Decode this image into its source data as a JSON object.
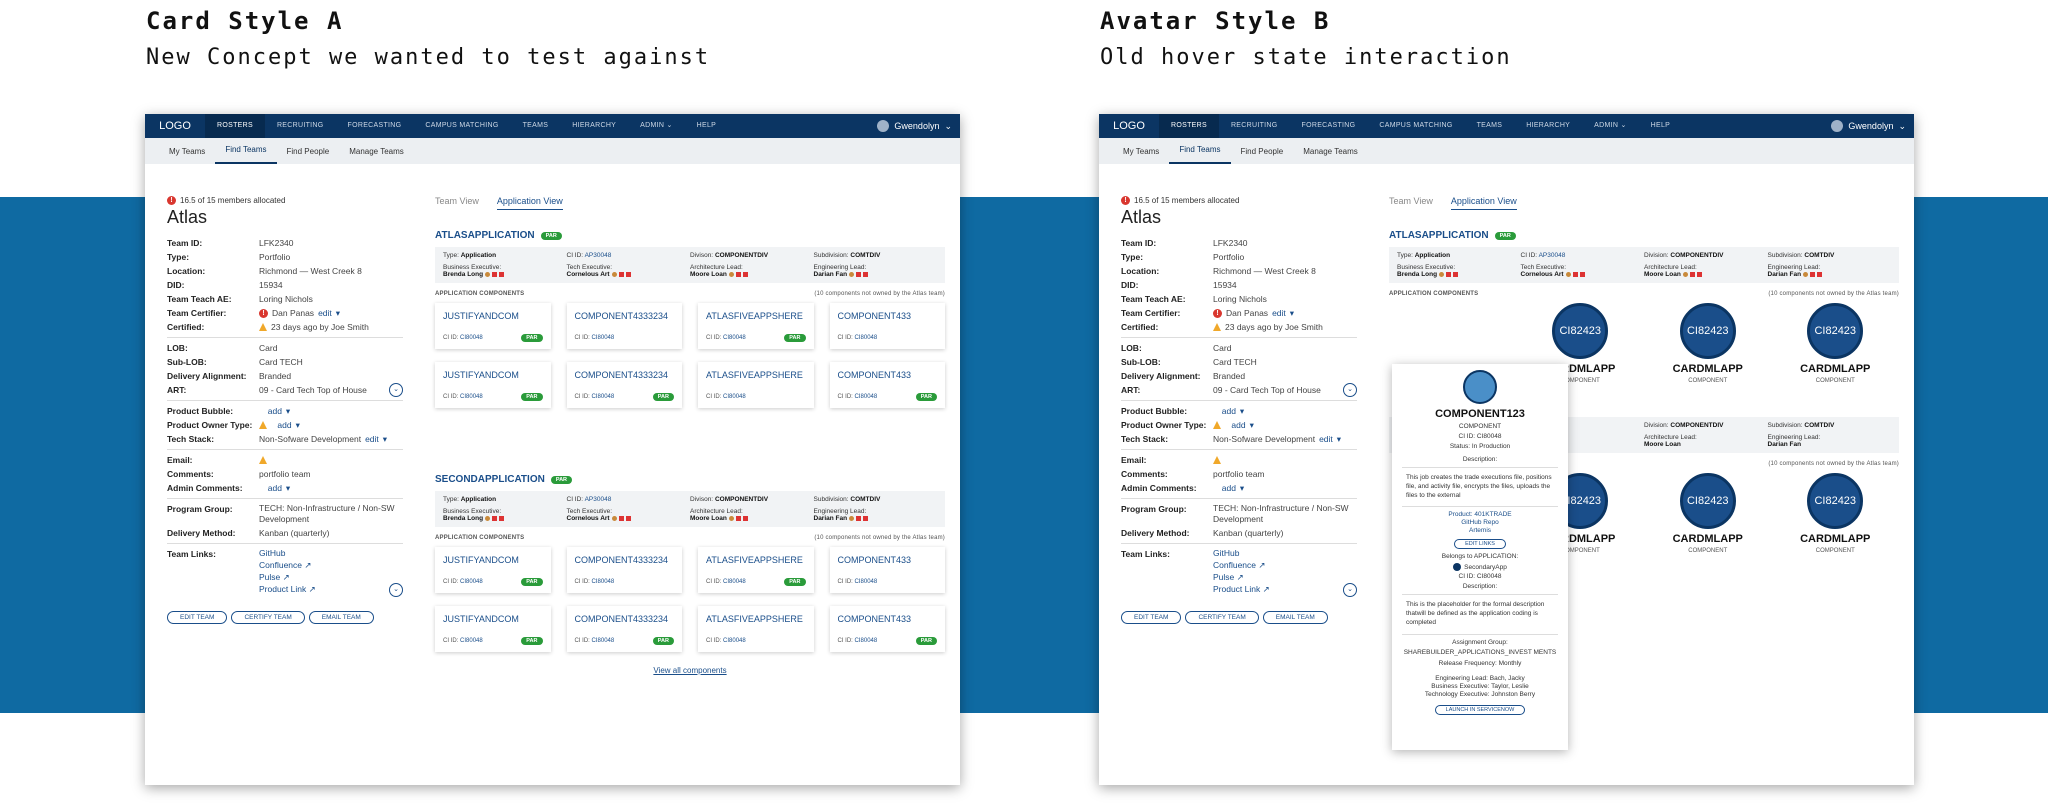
{
  "labels": {
    "a_title": "Card Style A",
    "a_subtitle": "New Concept we wanted to test against",
    "b_title": "Avatar Style B",
    "b_subtitle": "Old hover state interaction"
  },
  "nav": {
    "logo": "LOGO",
    "items": [
      "ROSTERS",
      "RECRUITING",
      "FORECASTING",
      "CAMPUS MATCHING",
      "TEAMS",
      "HIERARCHY",
      "ADMIN",
      "HELP"
    ],
    "user": "Gwendolyn"
  },
  "subnav": [
    "My Teams",
    "Find Teams",
    "Find People",
    "Manage Teams"
  ],
  "team": {
    "allocation": "16.5 of 15 members allocated",
    "name": "Atlas",
    "fields": {
      "team_id": {
        "k": "Team ID:",
        "v": "LFK2340"
      },
      "type": {
        "k": "Type:",
        "v": "Portfolio"
      },
      "location": {
        "k": "Location:",
        "v": "Richmond — West Creek 8"
      },
      "did": {
        "k": "DID:",
        "v": "15934"
      },
      "teach_ae": {
        "k": "Team Teach AE:",
        "v": "Loring Nichols"
      },
      "certifier": {
        "k": "Team Certifier:",
        "v": "Dan Panas",
        "edit": "edit"
      },
      "certified": {
        "k": "Certified:",
        "v": "23 days ago by Joe Smith"
      },
      "lob": {
        "k": "LOB:",
        "v": "Card"
      },
      "sublob": {
        "k": "Sub-LOB:",
        "v": "Card TECH"
      },
      "delivery_alignment": {
        "k": "Delivery Alignment:",
        "v": "Branded"
      },
      "art": {
        "k": "ART:",
        "v": "09 - Card Tech Top of House"
      },
      "product_bubble": {
        "k": "Product Bubble:",
        "v": "add"
      },
      "product_owner": {
        "k": "Product Owner Type:",
        "v": "add"
      },
      "tech_stack": {
        "k": "Tech Stack:",
        "v": "Non-Sofware Development",
        "edit": "edit"
      },
      "email": {
        "k": "Email:",
        "v": ""
      },
      "comments": {
        "k": "Comments:",
        "v": "portfolio team"
      },
      "admin_comments": {
        "k": "Admin Comments:",
        "v": "add"
      },
      "program_group": {
        "k": "Program Group:",
        "v": "TECH: Non-Infrastructure / Non-SW Development"
      },
      "delivery_method": {
        "k": "Delivery Method:",
        "v": "Kanban (quarterly)"
      },
      "team_links": {
        "k": "Team Links:",
        "links": [
          "GitHub",
          "Confluence",
          "Pulse",
          "Product Link"
        ]
      }
    },
    "buttons": [
      "EDIT TEAM",
      "CERTIFY TEAM",
      "EMAIL TEAM"
    ]
  },
  "view_tabs": [
    "Team View",
    "Application View"
  ],
  "apps": [
    {
      "name": "ATLASAPPLICATION",
      "badge": "PAR",
      "type": "Application",
      "ci_id": "AP30048",
      "division": "COMPONENTDIV",
      "subdivision": "COMTDIV",
      "business_exec": "Brenda Long",
      "tech_exec": "Cornelous Art",
      "arch_lead": "Moore Loan",
      "eng_lead": "Darian Fan",
      "components_label": "APPLICATION COMPONENTS",
      "components_note": "(10 components not owned by the Atlas team)",
      "cards": [
        {
          "name": "JUSTIFYANDCOM",
          "ci": "CI80048",
          "par": "PAR"
        },
        {
          "name": "COMPONENT4333234",
          "ci": "CI80048",
          "par": ""
        },
        {
          "name": "ATLASFIVEAPPSHERE",
          "ci": "CI80048",
          "par": "PAR"
        },
        {
          "name": "COMPONENT433",
          "ci": "CI80048",
          "par": ""
        },
        {
          "name": "JUSTIFYANDCOM",
          "ci": "CI80048",
          "par": "PAR"
        },
        {
          "name": "COMPONENT4333234",
          "ci": "CI80048",
          "par": "PAR"
        },
        {
          "name": "ATLASFIVEAPPSHERE",
          "ci": "CI80048",
          "par": ""
        },
        {
          "name": "COMPONENT433",
          "ci": "CI80048",
          "par": "PAR"
        }
      ]
    },
    {
      "name": "SECONDAPPLICATION",
      "badge": "PAR",
      "type": "Application",
      "ci_id": "AP30048",
      "division": "COMPONENTDIV",
      "subdivision": "COMTDIV",
      "business_exec": "Brenda Long",
      "tech_exec": "Cornelous Art",
      "arch_lead": "Moore Loan",
      "eng_lead": "Darian Fan",
      "components_label": "APPLICATION COMPONENTS",
      "components_note": "(10 components not owned by the Atlas team)",
      "cards": [
        {
          "name": "JUSTIFYANDCOM",
          "ci": "CI80048",
          "par": "PAR"
        },
        {
          "name": "COMPONENT4333234",
          "ci": "CI80048",
          "par": ""
        },
        {
          "name": "ATLASFIVEAPPSHERE",
          "ci": "CI80048",
          "par": "PAR"
        },
        {
          "name": "COMPONENT433",
          "ci": "CI80048",
          "par": ""
        },
        {
          "name": "JUSTIFYANDCOM",
          "ci": "CI80048",
          "par": "PAR"
        },
        {
          "name": "COMPONENT4333234",
          "ci": "CI80048",
          "par": "PAR"
        },
        {
          "name": "ATLASFIVEAPPSHERE",
          "ci": "CI80048",
          "par": ""
        },
        {
          "name": "COMPONENT433",
          "ci": "CI80048",
          "par": "PAR"
        }
      ]
    }
  ],
  "view_all": "View all components",
  "meta_labels": {
    "type": "Type:",
    "ci": "CI ID:",
    "division": "Divison:",
    "division_b": "Division:",
    "subdivision": "Subdivision:",
    "business_exec": "Business Executive:",
    "tech_exec": "Tech Executive:",
    "arch_lead": "Architecture Lead:",
    "eng_lead": "Engineering Lead:"
  },
  "b_avatars": [
    {
      "id": "CI82423",
      "name": "CARDMLAPP",
      "sub": "COMPONENT"
    },
    {
      "id": "CI82423",
      "name": "CARDMLAPP",
      "sub": "COMPONENT"
    },
    {
      "id": "CI82423",
      "name": "CARDMLAPP",
      "sub": "COMPONENT"
    }
  ],
  "b_partial": {
    "name": "RDMLAPP",
    "sub": "COMPONENT",
    "id": "2423"
  },
  "popover": {
    "name": "COMPONENT123",
    "kind": "COMPONENT",
    "ci": "CI ID: CI80048",
    "status": "Status: In Production",
    "desc_label": "Description:",
    "desc": "This job creates the trade executions file, positions file, and activity file, encrypts the files, uploads the files to the external",
    "product": "Product: 401KTRADE",
    "repo": "GitHub Repo",
    "artemis": "Artemis",
    "edit_links": "EDIT LINKS",
    "belongs_label": "Belongs to APPLICATION:",
    "secondary_app": "SecondaryApp",
    "ci2": "CI ID: CI80048",
    "desc_label2": "Description:",
    "desc2": "This is the placeholder for the formal description thatwill be defined as the application coding is completed",
    "assignment_group_label": "Assignment Group:",
    "assignment_group": "SHAREBUILDER_APPLICATIONS_INVEST MENTS",
    "release": "Release Frequency: Monthly",
    "eng_lead": "Engineering Lead: Bach, Jacky",
    "bus_exec": "Business Executive: Taylor, Leslie",
    "tech_exec": "Technology Executive: Johnston Berry",
    "launch": "LAUNCH IN SERVICENOW"
  },
  "colors": {
    "nav": "#0b3563",
    "band": "#0f6aa2",
    "accent": "#1a4e8a",
    "par": "#2a9b3a"
  }
}
